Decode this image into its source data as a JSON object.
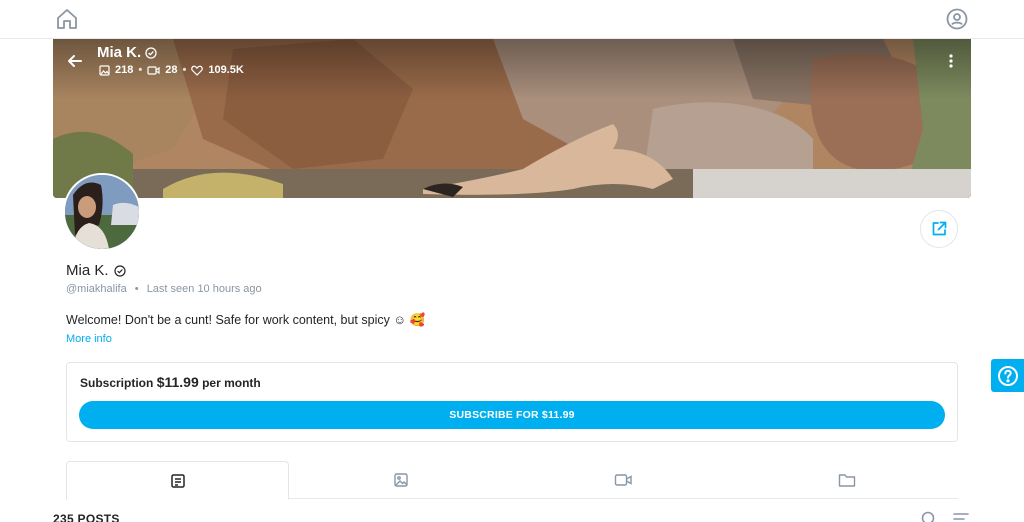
{
  "icons": {
    "home": "home-icon",
    "account": "account-icon",
    "back": "arrow-left-icon",
    "verified": "verified-badge-icon",
    "photo": "photo-icon",
    "video": "video-icon",
    "heart": "heart-icon",
    "more": "more-vertical-icon",
    "share": "share-icon",
    "help": "help-icon",
    "search": "search-icon",
    "sort": "sort-icon"
  },
  "colors": {
    "accent": "#00aff0",
    "muted": "#8a96a3",
    "text": "#242529"
  },
  "cover": {
    "name": "Mia K.",
    "stats": {
      "photos": "218",
      "videos": "28",
      "likes": "109.5K",
      "separator": "•"
    }
  },
  "profile": {
    "name": "Mia K.",
    "handle": "@miakhalifa",
    "separator": "•",
    "last_seen": "Last seen 10 hours ago",
    "bio": "Welcome! Don't be a cunt! Safe for work content, but spicy ☺ 🥰",
    "more_info": "More info"
  },
  "subscription": {
    "label": "Subscription",
    "price": "$11.99",
    "period": "per month",
    "button": "SUBSCRIBE FOR $11.99"
  },
  "tabs": [
    {
      "name": "posts",
      "icon": "posts-icon",
      "active": true
    },
    {
      "name": "photos",
      "icon": "photo-icon",
      "active": false
    },
    {
      "name": "videos",
      "icon": "video-icon",
      "active": false
    },
    {
      "name": "collections",
      "icon": "folder-icon",
      "active": false
    }
  ],
  "posts": {
    "count_label": "235 POSTS"
  }
}
